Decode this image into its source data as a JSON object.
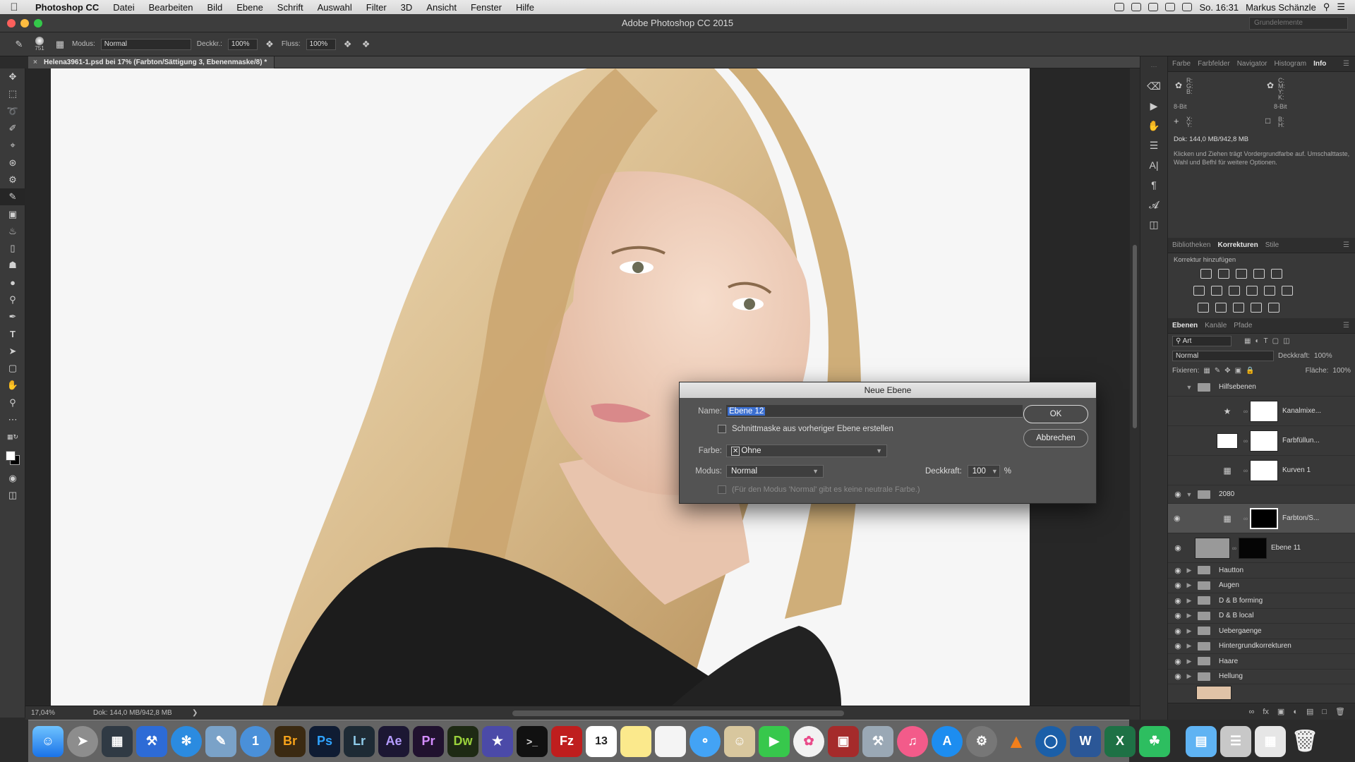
{
  "menubar": {
    "app": "Photoshop CC",
    "items": [
      "Datei",
      "Bearbeiten",
      "Bild",
      "Ebene",
      "Schrift",
      "Auswahl",
      "Filter",
      "3D",
      "Ansicht",
      "Fenster",
      "Hilfe"
    ],
    "clock": "So. 16:31",
    "user": "Markus Schänzle"
  },
  "window": {
    "title": "Adobe Photoshop CC 2015",
    "workspace": "Grundelemente"
  },
  "options": {
    "brush_size": "751",
    "mode_label": "Modus:",
    "mode_value": "Normal",
    "opacity_label": "Deckkr.:",
    "opacity_value": "100%",
    "flow_label": "Fluss:",
    "flow_value": "100%"
  },
  "document": {
    "tab_title": "Helena3961-1.psd bei 17% (Farbton/Sättigung 3, Ebenenmaske/8) *",
    "zoom": "17,04%",
    "doc_size": "Dok: 144,0 MB/942,8 MB"
  },
  "info_panel": {
    "tabs": [
      "Farbe",
      "Farbfelder",
      "Navigator",
      "Histogram",
      "Info"
    ],
    "active_tab": "Info",
    "rgb_labels": "R:\nG:\nB:",
    "cmyk_labels": "C:\nM:\nY:\nK:",
    "bit_left": "8-Bit",
    "bit_right": "8-Bit",
    "xy_labels": "X:\nY:",
    "bh_labels": "B:\nH:",
    "doc": "Dok: 144,0 MB/942,8 MB",
    "hint": "Klicken und Ziehen trägt Vordergrundfarbe auf. Umschalttaste, Wahl und Befhl für weitere Optionen."
  },
  "adjustments": {
    "tabs": [
      "Bibliotheken",
      "Korrekturen",
      "Stile"
    ],
    "active_tab": "Korrekturen",
    "label": "Korrektur hinzufügen"
  },
  "layers_panel": {
    "tabs": [
      "Ebenen",
      "Kanäle",
      "Pfade"
    ],
    "active_tab": "Ebenen",
    "filter": "Art",
    "blend": "Normal",
    "opacity_label": "Deckkraft:",
    "opacity": "100%",
    "lock_label": "Fixieren:",
    "fill_label": "Fläche:",
    "fill": "100%",
    "layers": [
      {
        "name": "Hilfsebenen",
        "type": "group",
        "open": true,
        "eye": false
      },
      {
        "name": "Kanalmixe...",
        "type": "adjust",
        "eye": false
      },
      {
        "name": "Farbfüllun...",
        "type": "fill",
        "eye": false
      },
      {
        "name": "Kurven 1",
        "type": "adjust",
        "eye": false
      },
      {
        "name": "2080",
        "type": "group",
        "open": true,
        "eye": true
      },
      {
        "name": "Farbton/S...",
        "type": "adjust-mask",
        "eye": true,
        "selected": true
      },
      {
        "name": "Ebene 11",
        "type": "pixel-mask",
        "eye": true
      },
      {
        "name": "Hautton",
        "type": "group",
        "eye": true
      },
      {
        "name": "Augen",
        "type": "group",
        "eye": true
      },
      {
        "name": "D & B forming",
        "type": "group",
        "eye": true
      },
      {
        "name": "D & B local",
        "type": "group",
        "eye": true
      },
      {
        "name": "Uebergaenge",
        "type": "group",
        "eye": true
      },
      {
        "name": "Hintergrundkorrekturen",
        "type": "group",
        "eye": true
      },
      {
        "name": "Haare",
        "type": "group",
        "eye": true
      },
      {
        "name": "Hellung",
        "type": "group",
        "eye": true
      }
    ]
  },
  "dialog": {
    "title": "Neue Ebene",
    "name_label": "Name:",
    "name_value": "Ebene 12",
    "clip_label": "Schnittmaske aus vorheriger Ebene erstellen",
    "color_label": "Farbe:",
    "color_value": "Ohne",
    "mode_label": "Modus:",
    "mode_value": "Normal",
    "opacity_label": "Deckkraft:",
    "opacity_value": "100",
    "percent": "%",
    "neutral_note": "(Für den Modus 'Normal' gibt es keine neutrale Farbe.)",
    "ok": "OK",
    "cancel": "Abbrechen"
  },
  "dock": {
    "apps": [
      "Finder",
      "Launchpad",
      "Mission Control",
      "Xcode",
      "Safari",
      "Preview",
      "1Password",
      "Br",
      "Ps",
      "Lr",
      "Ae",
      "Pr",
      "Dw",
      "iMovie",
      "Terminal",
      "FileZilla",
      "Calendar",
      "Notes",
      "Reminders",
      "Messages",
      "Contacts",
      "FaceTime",
      "Photos",
      "Photo Booth",
      "Utilities",
      "iTunes",
      "App Store",
      "System Preferences",
      "VLC",
      "Browser",
      "Word",
      "Excel",
      "Evernote",
      "Folder",
      "Downloads",
      "Trash"
    ],
    "calendar_day": "13"
  },
  "colors": {
    "ps_blue": "#2fa3ff",
    "accent_selection": "#3b6fd1",
    "dialog_bg": "#535353"
  }
}
